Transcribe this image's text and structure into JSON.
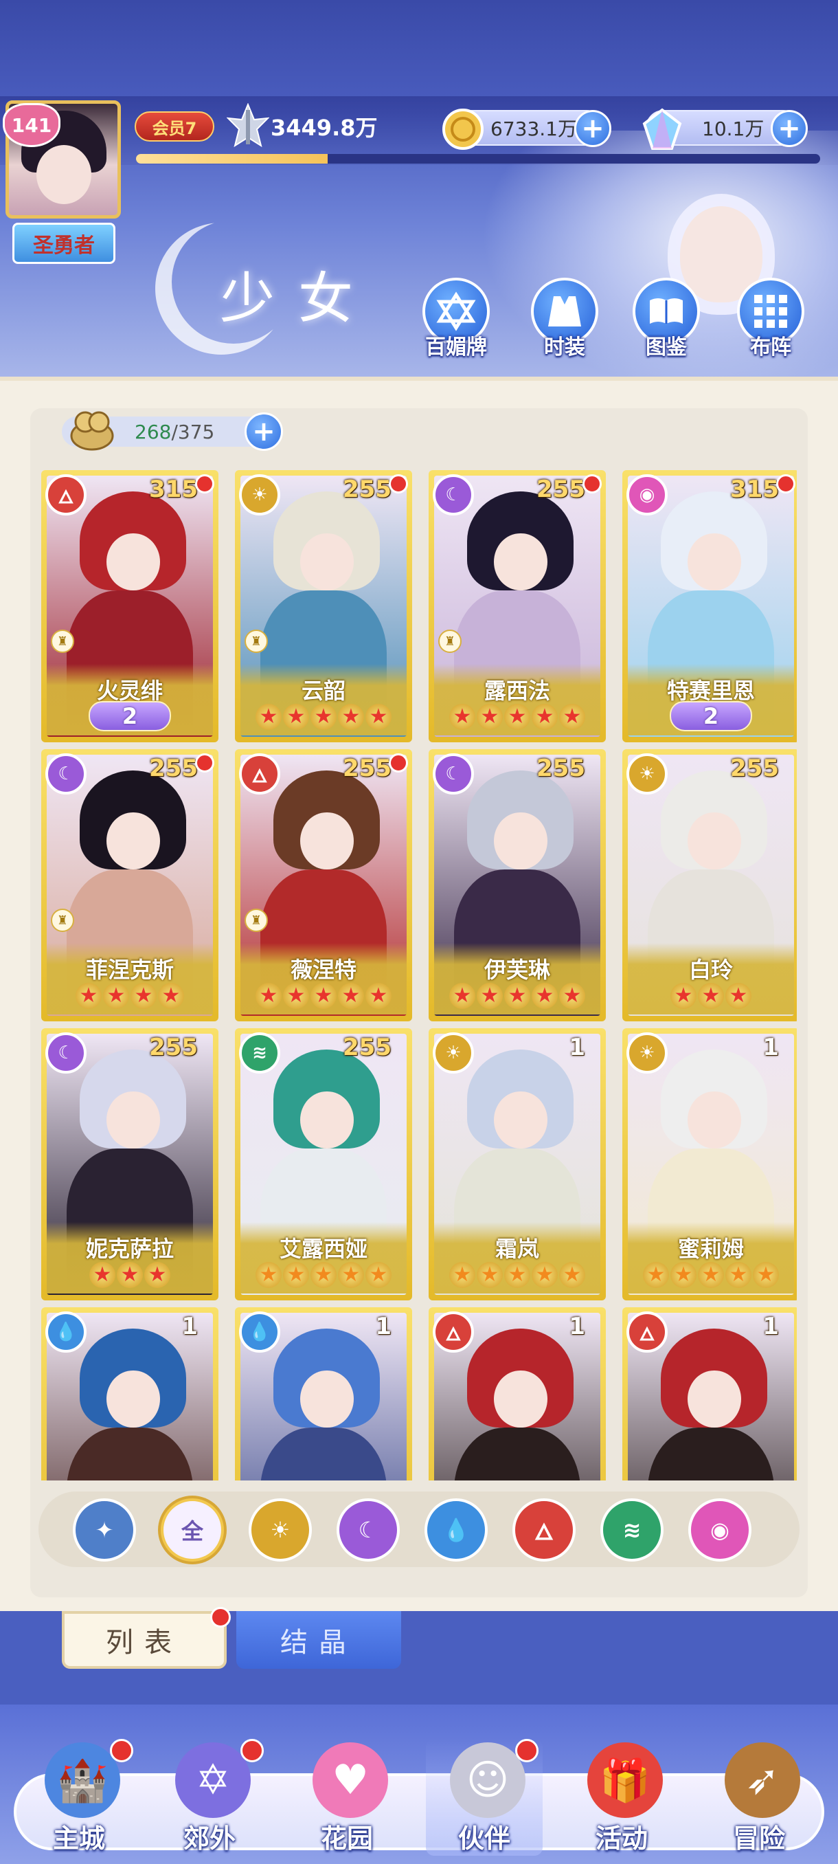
{
  "header": {
    "level": "141",
    "title_badge": "圣勇者",
    "vip": "会员7",
    "power": "3449.8万",
    "exp_progress": 0.28,
    "gold": "6733.1万",
    "gems": "10.1万",
    "plus": "+",
    "page_title": "少女",
    "nav": [
      {
        "label": "百媚牌",
        "icon": "card-deck-icon"
      },
      {
        "label": "时装",
        "icon": "outfit-icon"
      },
      {
        "label": "图鉴",
        "icon": "book-icon"
      },
      {
        "label": "布阵",
        "icon": "formation-grid-icon"
      }
    ]
  },
  "capacity": {
    "current": "268",
    "separator": "/",
    "max": "375"
  },
  "colors": {
    "fire": "#d8413a",
    "light": "#d9a72d",
    "dark": "#9a5ad8",
    "water": "#3d8fe0",
    "wind": "#2fa36a",
    "psychic": "#e056b8",
    "neutral": "#4f7fc9"
  },
  "cards": [
    {
      "name": "火灵绯",
      "level": "315",
      "element": "fire",
      "stars": 0,
      "awaken": "2",
      "dot": true,
      "rank": true,
      "hair": "#b6252b",
      "body": "#9c1f2a"
    },
    {
      "name": "云韶",
      "level": "255",
      "element": "light",
      "stars": 5,
      "awaken": "",
      "dot": true,
      "rank": true,
      "hair": "#e7e3d6",
      "body": "#4e8fb8"
    },
    {
      "name": "露西法",
      "level": "255",
      "element": "dark",
      "stars": 5,
      "awaken": "",
      "dot": true,
      "rank": true,
      "hair": "#1e1830",
      "body": "#c7b2d8"
    },
    {
      "name": "特赛里恩",
      "level": "315",
      "element": "psychic",
      "stars": 0,
      "awaken": "2",
      "dot": true,
      "rank": false,
      "hair": "#e8eef8",
      "body": "#9cd2ee"
    },
    {
      "name": "菲涅克斯",
      "level": "255",
      "element": "dark",
      "stars": 4,
      "awaken": "",
      "dot": true,
      "rank": true,
      "hair": "#1a1420",
      "body": "#d8a898"
    },
    {
      "name": "薇涅特",
      "level": "255",
      "element": "fire",
      "stars": 5,
      "awaken": "",
      "dot": true,
      "rank": true,
      "hair": "#6b3b26",
      "body": "#b22a2a"
    },
    {
      "name": "伊芙琳",
      "level": "255",
      "element": "dark",
      "stars": 5,
      "awaken": "",
      "dot": false,
      "rank": false,
      "hair": "#c4c8d8",
      "body": "#3a2a48"
    },
    {
      "name": "白玲",
      "level": "255",
      "element": "light",
      "stars": 3,
      "awaken": "",
      "dot": false,
      "rank": false,
      "hair": "#ecebe8",
      "body": "#e6e2dc"
    },
    {
      "name": "妮克萨拉",
      "level": "255",
      "element": "dark",
      "stars": 3,
      "awaken": "",
      "dot": false,
      "rank": false,
      "hair": "#d6d8ec",
      "body": "#2a2232"
    },
    {
      "name": "艾露西娅",
      "level": "255",
      "element": "wind",
      "stars": 5,
      "awaken": "",
      "dot": false,
      "rank": false,
      "hair": "#2f9e8e",
      "body": "#e8ecf0"
    },
    {
      "name": "霜岚",
      "level": "1",
      "element": "light",
      "stars": 5,
      "awaken": "",
      "dot": false,
      "rank": false,
      "hair": "#c8d2e8",
      "body": "#e4e4d8"
    },
    {
      "name": "蜜莉姆",
      "level": "1",
      "element": "light",
      "stars": 5,
      "awaken": "",
      "dot": false,
      "rank": false,
      "hair": "#eeeeee",
      "body": "#f2ead2"
    },
    {
      "name": "",
      "level": "1",
      "element": "water",
      "stars": 0,
      "awaken": "",
      "dot": false,
      "rank": false,
      "hair": "#2a64b0",
      "body": "#4a2a26"
    },
    {
      "name": "",
      "level": "1",
      "element": "water",
      "stars": 0,
      "awaken": "",
      "dot": false,
      "rank": false,
      "hair": "#4a7ad0",
      "body": "#3a4a8a"
    },
    {
      "name": "",
      "level": "1",
      "element": "fire",
      "stars": 0,
      "awaken": "",
      "dot": false,
      "rank": false,
      "hair": "#b6252b",
      "body": "#2a1e1e"
    },
    {
      "name": "",
      "level": "1",
      "element": "fire",
      "stars": 0,
      "awaken": "",
      "dot": false,
      "rank": false,
      "hair": "#b6252b",
      "body": "#2a1e1e"
    }
  ],
  "filters": [
    {
      "key": "neutral",
      "label": "",
      "icon": "star-up-icon"
    },
    {
      "key": "all",
      "label": "全",
      "icon": "all-icon"
    },
    {
      "key": "light",
      "label": "",
      "icon": "sun-icon"
    },
    {
      "key": "dark",
      "label": "",
      "icon": "moon-icon"
    },
    {
      "key": "water",
      "label": "",
      "icon": "water-drop-icon"
    },
    {
      "key": "fire",
      "label": "",
      "icon": "fire-icon"
    },
    {
      "key": "wind",
      "label": "",
      "icon": "tornado-icon"
    },
    {
      "key": "psychic",
      "label": "",
      "icon": "orbit-icon"
    }
  ],
  "tabs": {
    "list": "列表",
    "crystal": "结晶"
  },
  "bottom_nav": [
    {
      "label": "主城",
      "icon": "castle-icon",
      "dot": true
    },
    {
      "label": "郊外",
      "icon": "portal-icon",
      "dot": true
    },
    {
      "label": "花园",
      "icon": "heart-icon",
      "dot": false
    },
    {
      "label": "伙伴",
      "icon": "partner-icon",
      "dot": true
    },
    {
      "label": "活动",
      "icon": "gift-icon",
      "dot": false
    },
    {
      "label": "冒险",
      "icon": "compass-icon",
      "dot": false
    }
  ]
}
